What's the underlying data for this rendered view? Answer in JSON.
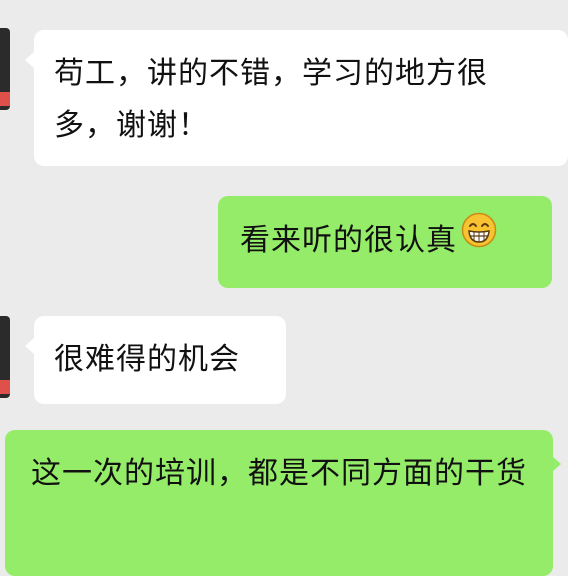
{
  "messages": [
    {
      "id": "m1",
      "side": "incoming",
      "text": "苟工，讲的不错，学习的地方很多，谢谢！"
    },
    {
      "id": "m2",
      "side": "outgoing",
      "text": "看来听的很认真",
      "emoji": "grin-emoji-icon"
    },
    {
      "id": "m3",
      "side": "incoming",
      "text": "很难得的机会"
    },
    {
      "id": "m4",
      "side": "outgoing",
      "text": "这一次的培训，都是不同方面的干货"
    }
  ],
  "colors": {
    "background": "#ebebeb",
    "incoming_bubble": "#ffffff",
    "outgoing_bubble": "#95ec69",
    "text": "#111111",
    "avatar_dark": "#2b2b2b",
    "avatar_accent": "#e0504a"
  }
}
